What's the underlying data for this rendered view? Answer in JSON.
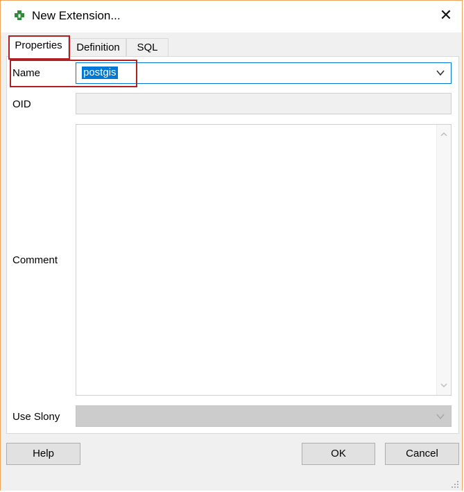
{
  "window": {
    "title": "New Extension...",
    "close_glyph": "✕",
    "app_icon": "puzzle-extension-icon"
  },
  "tabs": [
    {
      "label": "Properties",
      "active": true
    },
    {
      "label": "Definition",
      "active": false
    },
    {
      "label": "SQL",
      "active": false
    }
  ],
  "form": {
    "name_label": "Name",
    "name_value": "postgis",
    "oid_label": "OID",
    "oid_value": "",
    "comment_label": "Comment",
    "comment_value": "",
    "use_slony_label": "Use Slony",
    "use_slony_value": ""
  },
  "buttons": {
    "help": "Help",
    "ok": "OK",
    "cancel": "Cancel"
  },
  "colors": {
    "selection": "#0078d7",
    "highlight_box": "#b01f24",
    "window_border": "#f0a35a",
    "icon_green": "#2e8b3a"
  }
}
